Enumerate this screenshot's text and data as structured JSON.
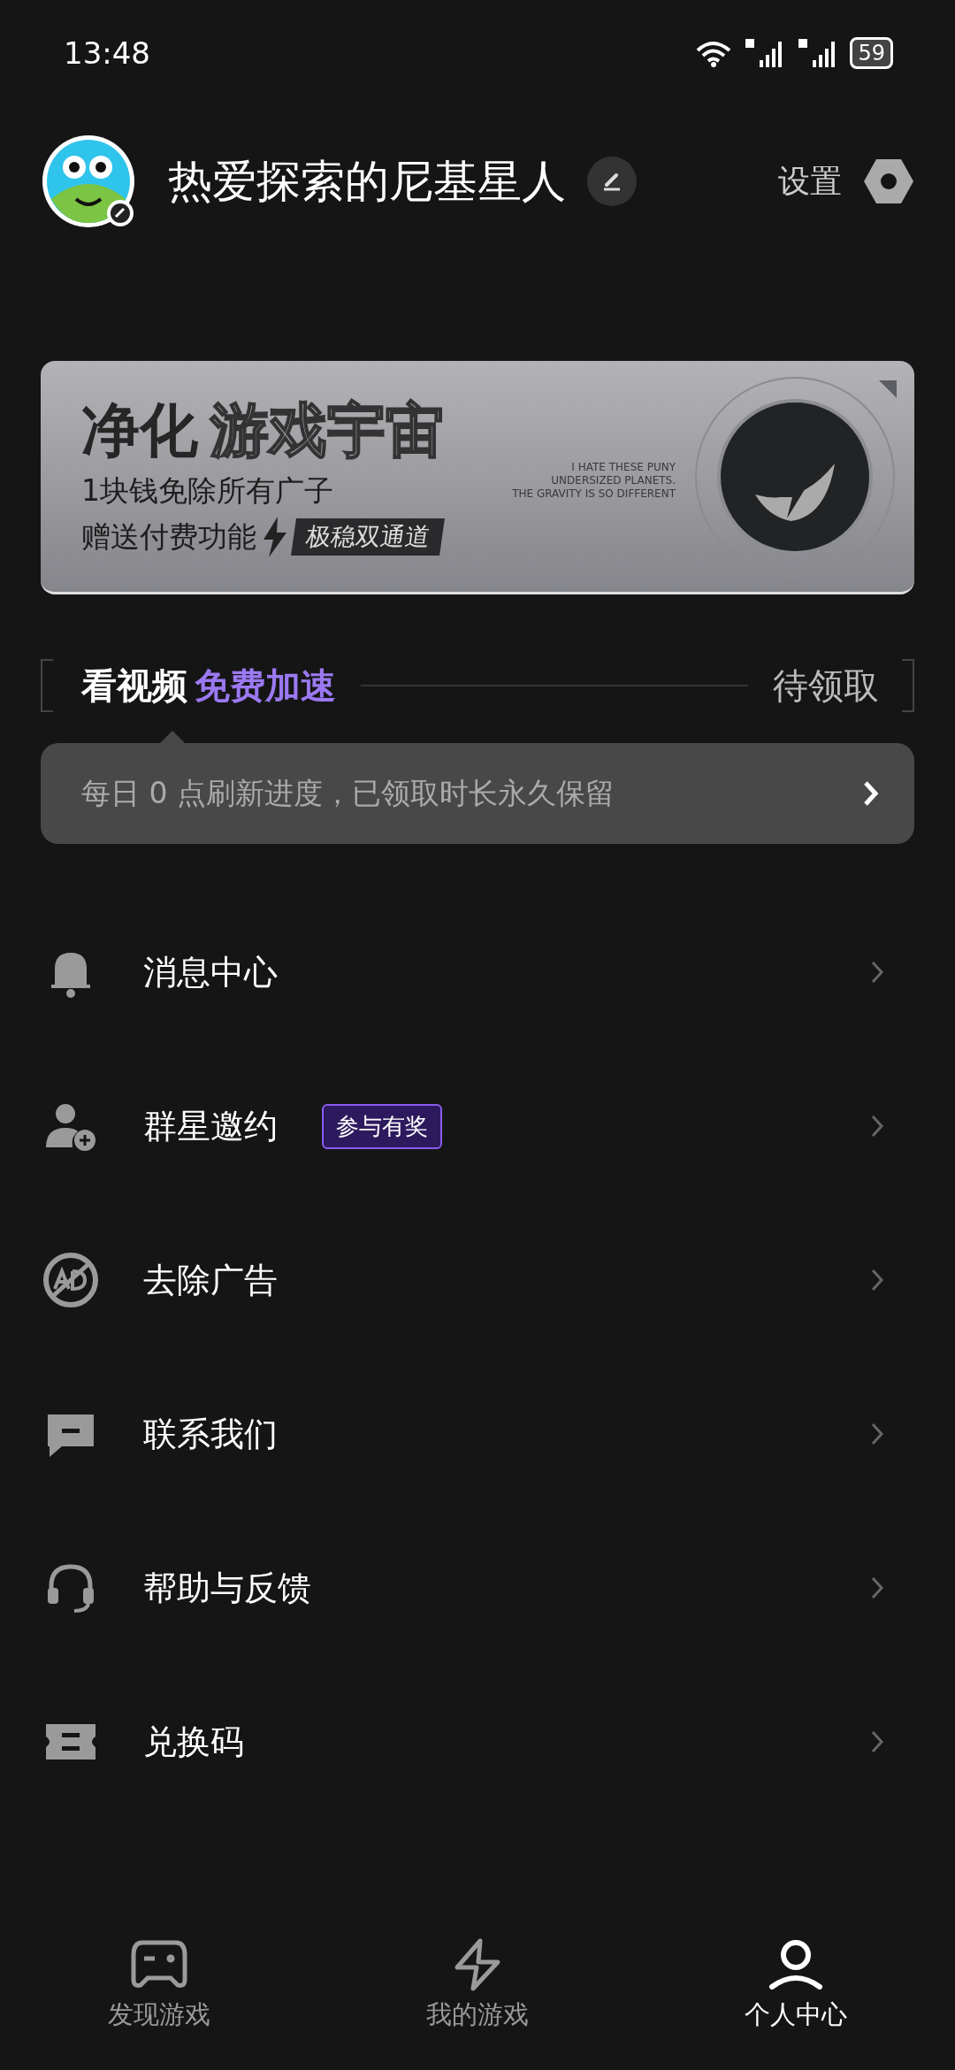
{
  "status_bar": {
    "time": "13:48",
    "battery": "59"
  },
  "profile": {
    "name": "热爱探索的尼基星人",
    "settings_label": "设置"
  },
  "banner": {
    "title_solid": "净化",
    "title_outline": "游戏宇宙",
    "line1": "1块钱免除所有广子",
    "line2": "赠送付费功能",
    "tag": "极稳双通道",
    "small_text": [
      "I HATE THESE PUNY",
      "UNDERSIZED PLANETS.",
      "THE GRAVITY IS SO DIFFERENT"
    ]
  },
  "video_boost": {
    "label": "看视频",
    "highlight": "免费加速",
    "status": "待领取",
    "tip": "每日 0 点刷新进度，已领取时长永久保留"
  },
  "menu": [
    {
      "kind": "bell",
      "label": "消息中心"
    },
    {
      "kind": "user-add",
      "label": "群星邀约",
      "badge": "参与有奖"
    },
    {
      "kind": "no-ad",
      "label": "去除广告"
    },
    {
      "kind": "chat",
      "label": "联系我们"
    },
    {
      "kind": "headset",
      "label": "帮助与反馈"
    },
    {
      "kind": "ticket",
      "label": "兑换码"
    }
  ],
  "tabs": [
    {
      "kind": "gamepad",
      "label": "发现游戏",
      "selected": false
    },
    {
      "kind": "bolt",
      "label": "我的游戏",
      "selected": false
    },
    {
      "kind": "person",
      "label": "个人中心",
      "selected": true
    }
  ]
}
